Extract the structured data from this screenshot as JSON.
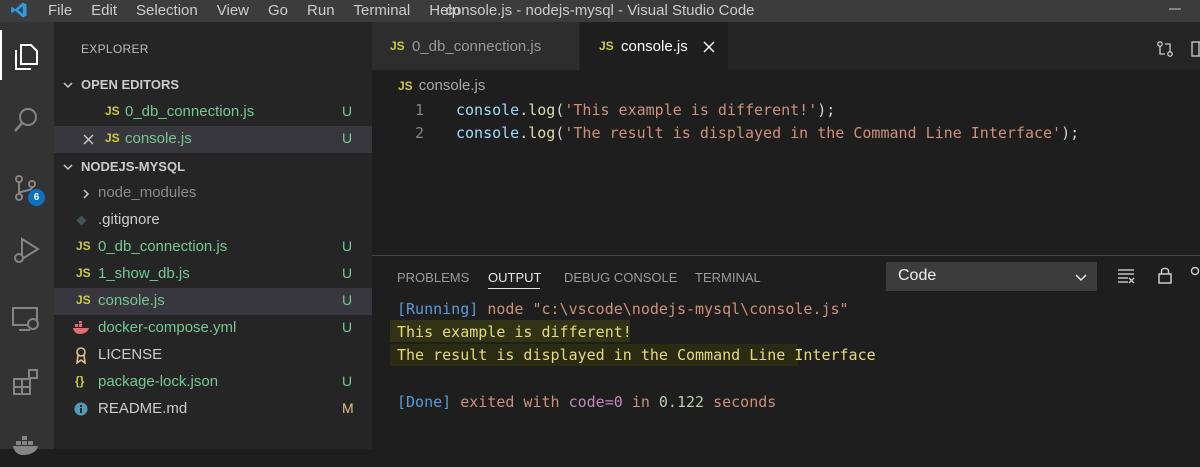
{
  "titlebar": {
    "menu": [
      "File",
      "Edit",
      "Selection",
      "View",
      "Go",
      "Run",
      "Terminal",
      "Help"
    ],
    "title": "console.js - nodejs-mysql - Visual Studio Code"
  },
  "activity": {
    "items": [
      "explorer-icon",
      "search-icon",
      "source-control-icon",
      "run-debug-icon",
      "remote-explorer-icon",
      "extensions-icon",
      "docker-icon"
    ],
    "scm_badge": "6"
  },
  "sidebar": {
    "title": "EXPLORER",
    "open_editors_label": "OPEN EDITORS",
    "open_editors": [
      {
        "icon": "JS",
        "name": "0_db_connection.js",
        "status": "U"
      },
      {
        "icon": "JS",
        "name": "console.js",
        "status": "U"
      }
    ],
    "project_label": "NODEJS-MYSQL",
    "files": [
      {
        "icon": ">",
        "name": "node_modules",
        "status": ""
      },
      {
        "icon": "git",
        "name": ".gitignore",
        "status": ""
      },
      {
        "icon": "JS",
        "name": "0_db_connection.js",
        "status": "U"
      },
      {
        "icon": "JS",
        "name": "1_show_db.js",
        "status": "U"
      },
      {
        "icon": "JS",
        "name": "console.js",
        "status": "U"
      },
      {
        "icon": "docker",
        "name": "docker-compose.yml",
        "status": "U"
      },
      {
        "icon": "license",
        "name": "LICENSE",
        "status": ""
      },
      {
        "icon": "{}",
        "name": "package-lock.json",
        "status": "U"
      },
      {
        "icon": "info",
        "name": "README.md",
        "status": "M"
      }
    ]
  },
  "tabs": [
    {
      "icon": "JS",
      "label": "0_db_connection.js",
      "active": false
    },
    {
      "icon": "JS",
      "label": "console.js",
      "active": true
    }
  ],
  "editor": {
    "breadcrumb": "console.js",
    "breadcrumb_icon": "JS",
    "lines": [
      {
        "num": "1",
        "obj": "console",
        "dot": ".",
        "fn": "log",
        "open": "(",
        "str": "'This example is different!'",
        "close": ");"
      },
      {
        "num": "2",
        "obj": "console",
        "dot": ".",
        "fn": "log",
        "open": "(",
        "str": "'The result is displayed in the Command Line Interface'",
        "close": ");"
      }
    ]
  },
  "panel": {
    "tabs": [
      "PROBLEMS",
      "OUTPUT",
      "DEBUG CONSOLE",
      "TERMINAL"
    ],
    "active_tab": "OUTPUT",
    "select_value": "Code",
    "output": {
      "running_tag": "[Running]",
      "running_cmd": "node \"c:\\vscode\\nodejs-mysql\\console.js\"",
      "line1": "This example is different!",
      "line2": "The result is displayed in the Command Line Interface",
      "done_tag": "[Done]",
      "done_text1": "exited with",
      "done_code": "code=0",
      "done_text2": "in",
      "done_time": "0.122",
      "done_text3": "seconds"
    }
  },
  "colors": {
    "accent": "#0e70c0",
    "untracked": "#73c991",
    "modified": "#e2c08d",
    "js_icon": "#cbcb41"
  }
}
